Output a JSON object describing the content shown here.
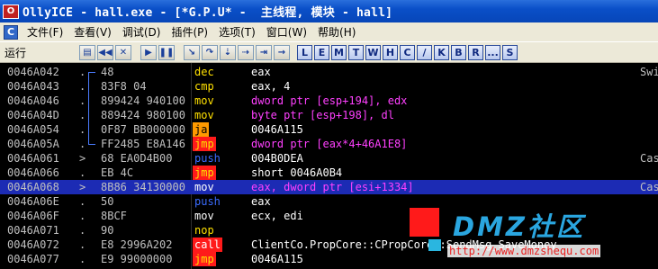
{
  "window": {
    "icon_letter": "O",
    "title": "OllyICE - hall.exe - [*G.P.U* -  主线程, 模块 - hall]"
  },
  "menu": {
    "logo_letter": "C",
    "items": [
      "文件(F)",
      "查看(V)",
      "调试(D)",
      "插件(P)",
      "选项(T)",
      "窗口(W)",
      "帮助(H)"
    ]
  },
  "toolbar": {
    "status": "运行",
    "buttons": [
      {
        "name": "open-button",
        "glyph": "▤"
      },
      {
        "name": "restart-button",
        "glyph": "◀◀"
      },
      {
        "name": "close-button",
        "glyph": "✕"
      },
      {
        "name": "run-button",
        "glyph": "▶"
      },
      {
        "name": "pause-button",
        "glyph": "❚❚"
      },
      {
        "name": "step-into-button",
        "glyph": "↘"
      },
      {
        "name": "step-over-button",
        "glyph": "↷"
      },
      {
        "name": "trace-into-button",
        "glyph": "⇣"
      },
      {
        "name": "trace-over-button",
        "glyph": "⇢"
      },
      {
        "name": "execute-till-return-button",
        "glyph": "⇥"
      },
      {
        "name": "goto-button",
        "glyph": "→"
      }
    ],
    "letters": [
      "L",
      "E",
      "M",
      "T",
      "W",
      "H",
      "C",
      "/",
      "K",
      "B",
      "R",
      "...",
      "S"
    ]
  },
  "disasm": {
    "colors": {
      "mnem_default": "#ffffff",
      "jump_yellow": "#ffe000",
      "call_bg": "#ff1a1a",
      "push_blue": "#3a6cff",
      "jump_bg_orange": "#ff9a00",
      "nop_yellow": "#ffe000",
      "operand_purple": "#ff40ff",
      "operand_white": "#ffffff"
    },
    "rows": [
      {
        "addr": "0046A042",
        "mark": ".",
        "bytes": "48",
        "mnem": "dec",
        "ops": "eax",
        "comment": "Swi",
        "style": "plain"
      },
      {
        "addr": "0046A043",
        "mark": ".",
        "bytes": "83F8 04",
        "mnem": "cmp",
        "ops": "eax, 4",
        "comment": "",
        "style": "plain"
      },
      {
        "addr": "0046A046",
        "mark": ".",
        "bytes": "899424 940100",
        "mnem": "mov",
        "ops": "dword ptr [esp+194], edx",
        "comment": "",
        "style": "mem"
      },
      {
        "addr": "0046A04D",
        "mark": ".",
        "bytes": "889424 980100",
        "mnem": "mov",
        "ops": "byte ptr [esp+198], dl",
        "comment": "",
        "style": "mem"
      },
      {
        "addr": "0046A054",
        "mark": ".",
        "bytes": "0F87 BB000000",
        "mnem": "ja",
        "ops": "0046A115",
        "comment": "",
        "style": "jcc"
      },
      {
        "addr": "0046A05A",
        "mark": ".",
        "bytes": "FF2485 E8A146",
        "mnem": "jmp",
        "ops": "dword ptr [eax*4+46A1E8]",
        "comment": "",
        "style": "jmpmem"
      },
      {
        "addr": "0046A061",
        "mark": ">",
        "bytes": "68 EA0D4B00",
        "mnem": "push",
        "ops": "004B0DEA",
        "comment": "Cas",
        "style": "push"
      },
      {
        "addr": "0046A066",
        "mark": ".",
        "bytes": "EB 4C",
        "mnem": "jmp",
        "ops": "short 0046A0B4",
        "comment": "",
        "style": "jmp"
      },
      {
        "addr": "0046A068",
        "mark": ">",
        "bytes": "8B86 34130000",
        "mnem": "mov",
        "ops": "eax, dword ptr [esi+1334]",
        "comment": "Cas",
        "style": "selected"
      },
      {
        "addr": "0046A06E",
        "mark": ".",
        "bytes": "50",
        "mnem": "push",
        "ops": "eax",
        "comment": "",
        "style": "push"
      },
      {
        "addr": "0046A06F",
        "mark": ".",
        "bytes": "8BCF",
        "mnem": "mov",
        "ops": "ecx, edi",
        "comment": "",
        "style": "plain"
      },
      {
        "addr": "0046A071",
        "mark": ".",
        "bytes": "90",
        "mnem": "nop",
        "ops": "",
        "comment": "",
        "style": "nop"
      },
      {
        "addr": "0046A072",
        "mark": ".",
        "bytes": "E8 2996A202",
        "mnem": "call",
        "ops": "ClientCo.PropCore::CPropCore::SendMsg_SaveMoney",
        "comment": "",
        "style": "call"
      },
      {
        "addr": "0046A077",
        "mark": ".",
        "bytes": "E9 99000000",
        "mnem": "jmp",
        "ops": "0046A115",
        "comment": "",
        "style": "jmp"
      }
    ]
  },
  "watermark": {
    "text": "DMZ社区",
    "url": "http://www.dmzshequ.com"
  }
}
